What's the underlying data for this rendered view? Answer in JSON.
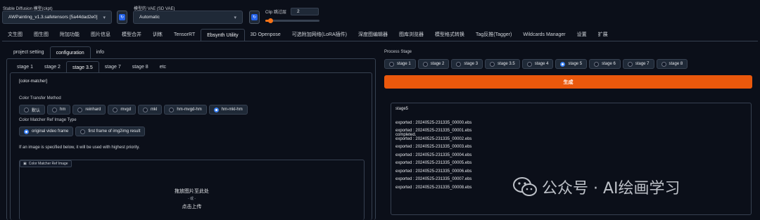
{
  "top": {
    "checkpoint_label": "Stable Diffusion 模型(ckpt)",
    "checkpoint_value": "AWPainting_v1.3.safetensors [5a44dad2e0]",
    "vae_label": "模型的 VAE (SD VAE)",
    "vae_value": "Automatic",
    "clip_label": "Clip 跳过层",
    "clip_value": "2",
    "clip_min": 1,
    "clip_max": 12
  },
  "main_tabs": [
    "文生图",
    "图生图",
    "附加功能",
    "图片信息",
    "模型合并",
    "训练",
    "TensorRT",
    "Ebsynth Utility",
    "3D Openpose",
    "可选附加网络(LoRA插件)",
    "深度图编辑器",
    "图库浏览器",
    "模型格式转换",
    "Tag反推(Tagger)",
    "Wildcards Manager",
    "设置",
    "扩展"
  ],
  "main_active": "Ebsynth Utility",
  "sub_tabs": [
    "project setting",
    "configuration",
    "info"
  ],
  "sub_active": "configuration",
  "stage_tabs": [
    "stage 1",
    "stage 2",
    "stage 3.5",
    "stage 7",
    "stage 8",
    "etc"
  ],
  "stage_active": "stage 3.5",
  "config": {
    "section_title": "[color-matcher]",
    "transfer_label": "Color Transfer Method",
    "transfer_options": [
      "默认",
      "hm",
      "reinhard",
      "mvgd",
      "mkl",
      "hm-mvgd-hm",
      "hm-mkl-hm"
    ],
    "transfer_selected": "hm-mkl-hm",
    "ref_type_label": "Color Matcher Ref Image Type",
    "ref_type_options": [
      "original video frame",
      "first frame of img2img result"
    ],
    "ref_type_selected": "original video frame",
    "note": "If an image is specified below, it will be used with highest priority.",
    "ref_image_label": "Color Matcher Ref Image",
    "drop_text": "拖放图片至此处",
    "or_text": "- 或 -",
    "upload_text": "点击上传"
  },
  "right": {
    "process_label": "Process Stage",
    "stages": [
      "stage 1",
      "stage 2",
      "stage 3",
      "stage 3.5",
      "stage 4",
      "stage 5",
      "stage 6",
      "stage 7",
      "stage 8"
    ],
    "stage_selected": "stage 5",
    "generate_label": "生成",
    "log_title": "stage5",
    "log_lines": [
      "exported : 20240525-231335_00000.ebs",
      "exported : 20240525-231335_00001.ebs",
      "exported : 20240525-231335_00002.ebs",
      "exported : 20240525-231335_00003.ebs",
      "exported : 20240525-231335_00004.ebs",
      "exported : 20240525-231335_00005.ebs",
      "exported : 20240525-231335_00006.ebs",
      "exported : 20240525-231335_00007.ebs",
      "exported : 20240525-231335_00008.ebs"
    ],
    "log_done": "completed."
  },
  "watermark": "公众号 · AI绘画学习",
  "colors": {
    "accent": "#ea580c",
    "radio_on": "#3b82f6",
    "background": "#0b0f19"
  }
}
